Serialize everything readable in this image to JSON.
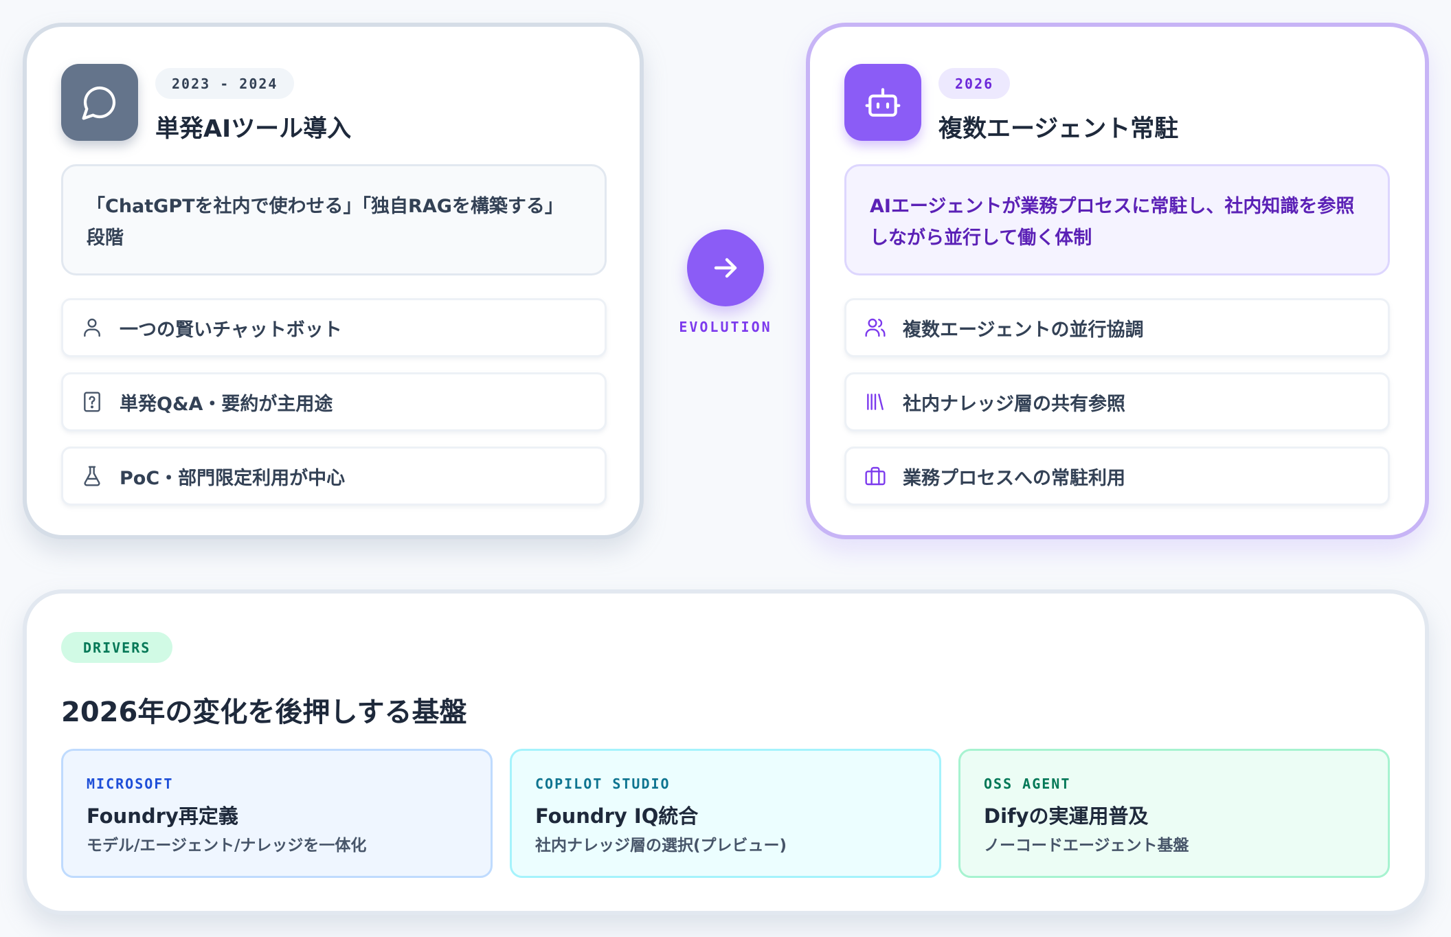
{
  "before": {
    "year": "2023 - 2024",
    "title": "単発AIツール導入",
    "icon": "chat-bubble-icon",
    "description": "「ChatGPTを社内で使わせる」「独自RAGを構築する」段階",
    "features": [
      {
        "icon": "user-icon",
        "label": "一つの賢いチャットボット"
      },
      {
        "icon": "question-file-icon",
        "label": "単発Q&A・要約が主用途"
      },
      {
        "icon": "flask-icon",
        "label": "PoC・部門限定利用が中心"
      }
    ],
    "accent": "#64748b"
  },
  "transition": {
    "label": "EVOLUTION",
    "icon": "arrow-right-icon",
    "accent": "#8b5cf6"
  },
  "after": {
    "year": "2026",
    "title": "複数エージェント常駐",
    "icon": "bot-icon",
    "description": "AIエージェントが業務プロセスに常駐し、社内知識を参照しながら並行して働く体制",
    "features": [
      {
        "icon": "users-icon",
        "label": "複数エージェントの並行協調"
      },
      {
        "icon": "library-icon",
        "label": "社内ナレッジ層の共有参照"
      },
      {
        "icon": "briefcase-icon",
        "label": "業務プロセスへの常駐利用"
      }
    ],
    "accent": "#8b5cf6"
  },
  "drivers": {
    "tag": "DRIVERS",
    "title": "2026年の変化を後押しする基盤",
    "items": [
      {
        "tag": "MICROSOFT",
        "name": "Foundry再定義",
        "sub": "モデル/エージェント/ナレッジを一体化",
        "color": "#1d4ed8"
      },
      {
        "tag": "COPILOT STUDIO",
        "name": "Foundry IQ統合",
        "sub": "社内ナレッジ層の選択(プレビュー)",
        "color": "#0e7490"
      },
      {
        "tag": "OSS AGENT",
        "name": "Difyの実運用普及",
        "sub": "ノーコードエージェント基盤",
        "color": "#047857"
      }
    ]
  }
}
